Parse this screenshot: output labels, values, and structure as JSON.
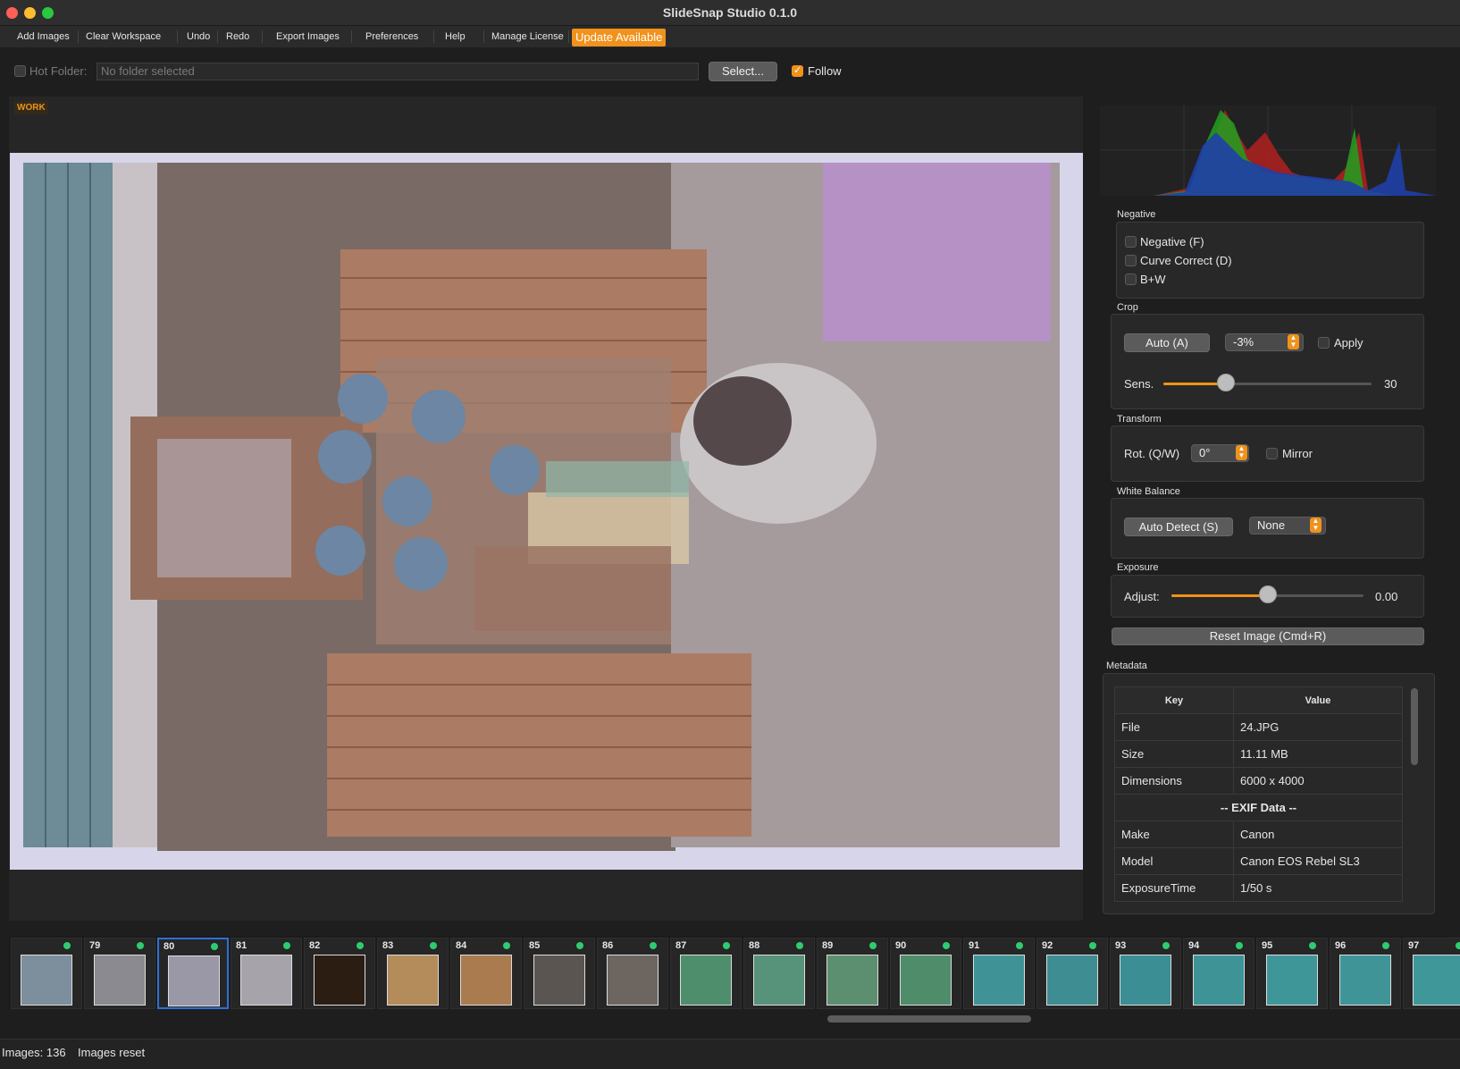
{
  "window": {
    "title": "SlideSnap Studio 0.1.0"
  },
  "menu": {
    "items": [
      "Add Images",
      "Clear Workspace",
      "Undo",
      "Redo",
      "Export Images",
      "Preferences",
      "Help",
      "Manage License"
    ],
    "update": "Update Available"
  },
  "hot_folder": {
    "label": "Hot Folder:",
    "value": "No folder selected",
    "select_button": "Select...",
    "follow_label": "Follow",
    "follow_checked": true
  },
  "canvas": {
    "badge": "WORK"
  },
  "negative": {
    "title": "Negative",
    "options": [
      "Negative (F)",
      "Curve Correct (D)",
      "B+W"
    ]
  },
  "crop": {
    "title": "Crop",
    "auto_button": "Auto (A)",
    "percent": "-3%",
    "apply_label": "Apply",
    "sens_label": "Sens.",
    "sens_value": "30",
    "sens_level": 0.3
  },
  "transform": {
    "title": "Transform",
    "rot_label": "Rot. (Q/W)",
    "rot_value": "0°",
    "mirror_label": "Mirror"
  },
  "white_balance": {
    "title": "White Balance",
    "auto_button": "Auto Detect (S)",
    "preset": "None"
  },
  "exposure": {
    "title": "Exposure",
    "adjust_label": "Adjust:",
    "value": "0.00",
    "level": 0.5
  },
  "reset_button": "Reset Image (Cmd+R)",
  "metadata": {
    "title": "Metadata",
    "headers": [
      "Key",
      "Value"
    ],
    "rows": [
      [
        "File",
        "24.JPG"
      ],
      [
        "Size",
        "11.11 MB"
      ],
      [
        "Dimensions",
        "6000 x 4000"
      ],
      [
        "-- EXIF Data --",
        ""
      ],
      [
        "Make",
        "Canon"
      ],
      [
        "Model",
        "Canon EOS Rebel SL3"
      ],
      [
        "ExposureTime",
        "1/50 s"
      ]
    ]
  },
  "filmstrip": {
    "numbers": [
      "",
      "79",
      "80",
      "81",
      "82",
      "83",
      "84",
      "85",
      "86",
      "87",
      "88",
      "89",
      "90",
      "91",
      "92",
      "93",
      "94",
      "95",
      "96",
      "97"
    ],
    "selected_index": 2
  },
  "status": {
    "images": "Images: 136",
    "message": "Images reset"
  },
  "colors": {
    "accent": "#f0921c",
    "status_dot": "#2ecc71",
    "selected_border": "#2f6fd8"
  }
}
